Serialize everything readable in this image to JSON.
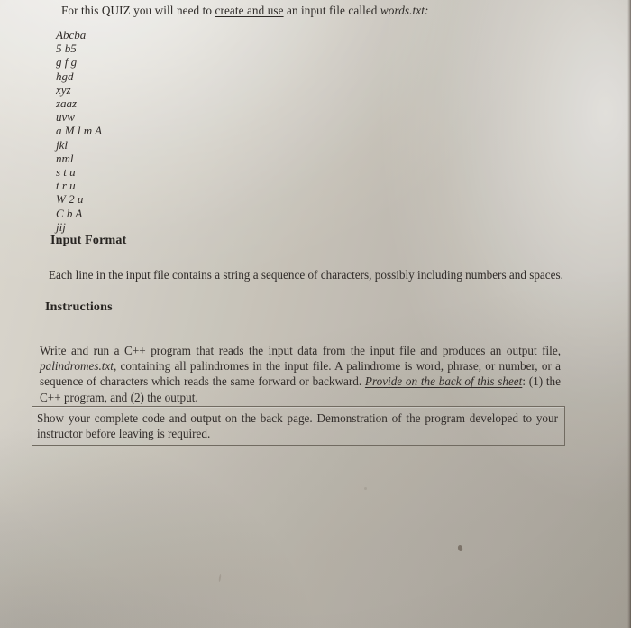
{
  "document": {
    "intro": {
      "before_underline": "For this QUIZ you will need to ",
      "underlined": "create and use",
      "after_underline": " an input file called ",
      "filename_italic": "words.txt:"
    },
    "word_list": [
      "Abcba",
      "5 b5",
      "g f g",
      "hgd",
      "xyz",
      "zaaz",
      "uvw",
      "a M l m A",
      "jkl",
      "nml",
      "s t u",
      "t r u",
      "W 2 u",
      "C b A",
      "jij"
    ],
    "input_format": {
      "heading": "Input Format",
      "body": "Each line in the input file contains a string a sequence of characters, possibly including numbers and spaces."
    },
    "instructions": {
      "heading": "Instructions",
      "part1": "Write and run a C++ program that reads the input data from the input file and produces an output file, ",
      "file_italic": "palindromes.txt",
      "part2": ", containing all palindromes in the input file. A palindrome is word, phrase, or number, or a sequence of characters which reads the same forward or backward. ",
      "provide_italic_underlined": "Provide on the back of this sheet",
      "part3": ": (1) the C++ program, and (2) the output."
    },
    "note": {
      "line1": "Show your complete code and output on the back page.  Demonstration of the program",
      "line2": "developed to your instructor before leaving is required."
    }
  }
}
